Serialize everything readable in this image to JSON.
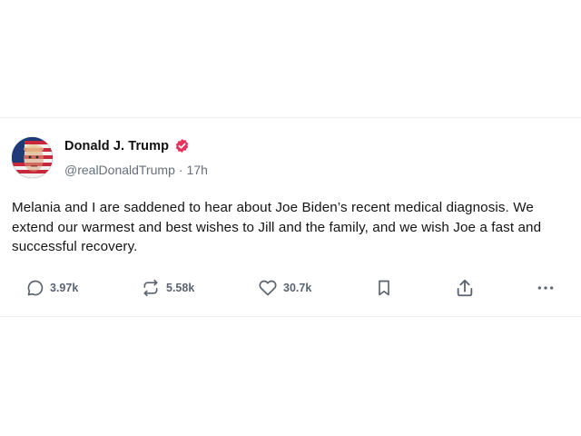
{
  "post": {
    "author": {
      "display_name": "Donald J. Trump",
      "handle": "@realDonaldTrump",
      "separator": "·",
      "time_ago": "17h",
      "verified": true,
      "badge_color": "#e5325f"
    },
    "text": "Melania and I are saddened to hear about Joe Biden’s recent medical diagnosis. We extend our warmest and best wishes to Jill and the family, and we wish Joe a fast and successful recovery.",
    "actions": {
      "replies": "3.97k",
      "reposts": "5.58k",
      "likes": "30.7k"
    },
    "icons": [
      "reply-icon",
      "repost-icon",
      "like-icon",
      "bookmark-icon",
      "share-icon",
      "more-icon"
    ],
    "icon_color": "#5a6470"
  }
}
